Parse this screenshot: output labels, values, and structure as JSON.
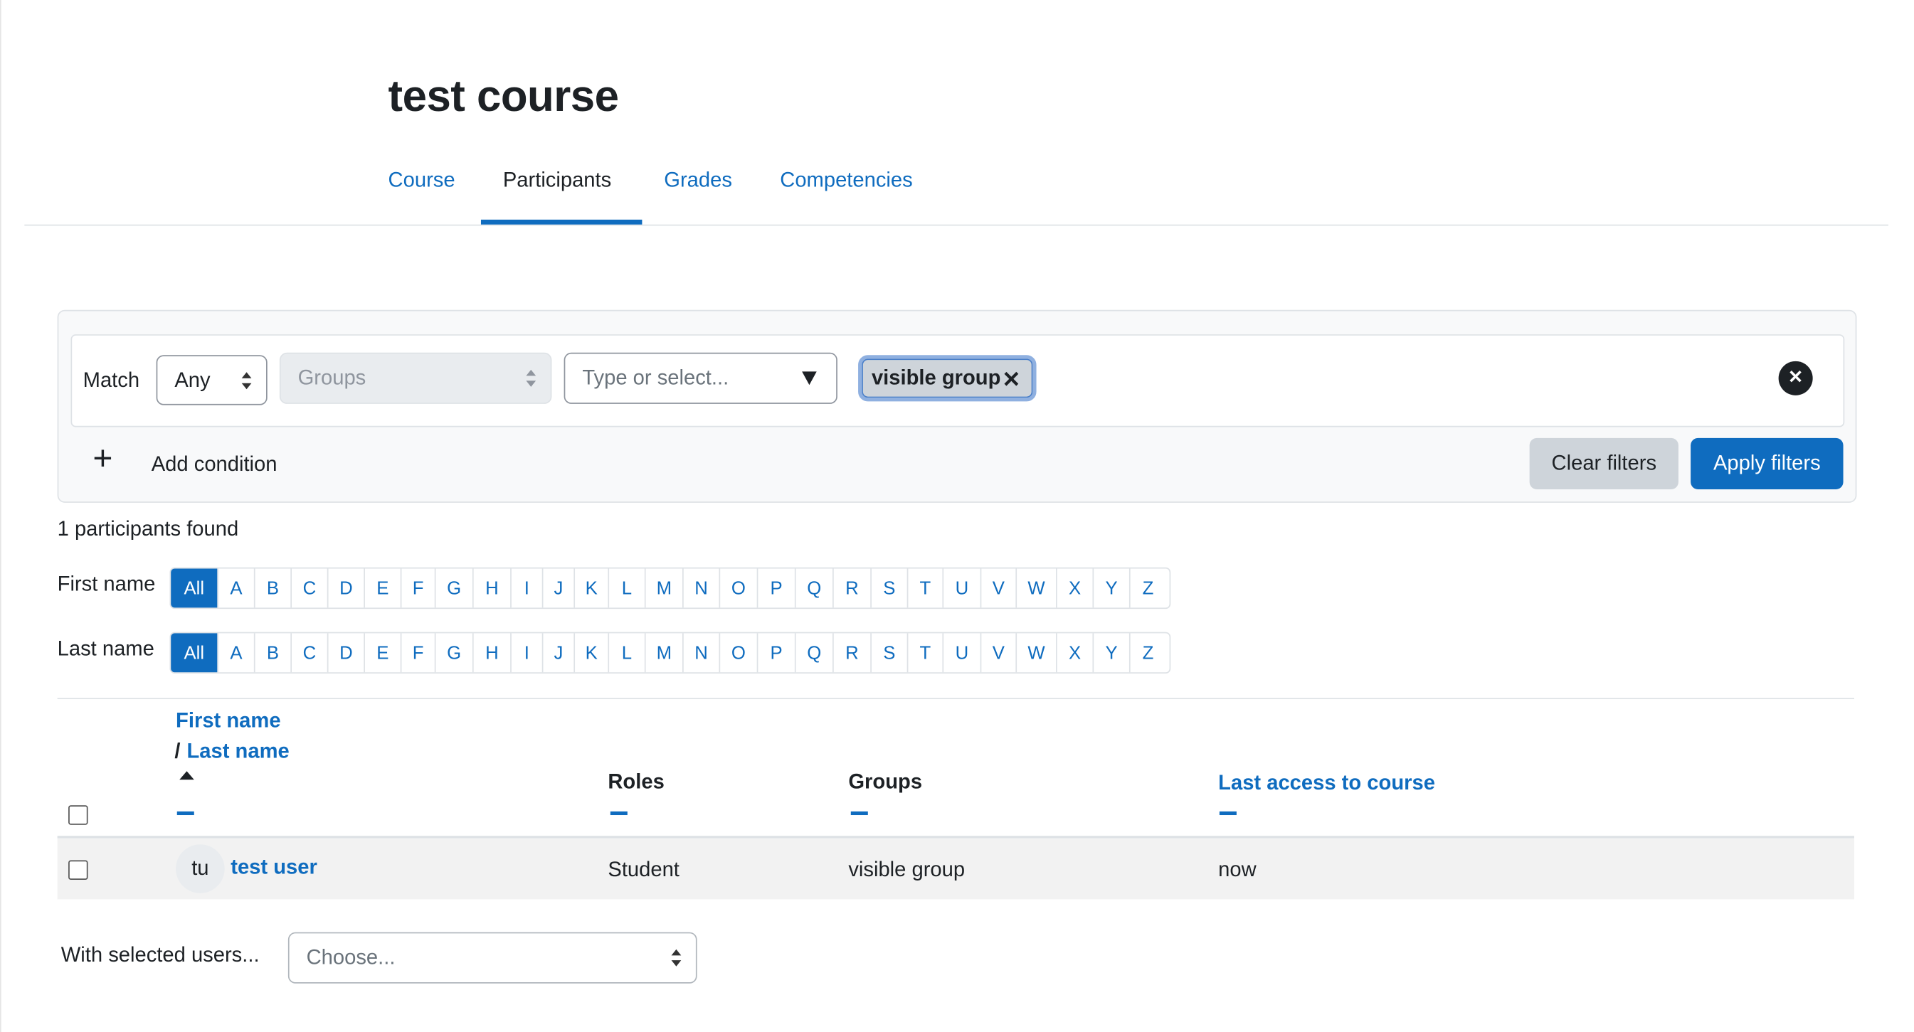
{
  "course_title": "test course",
  "tabs": [
    {
      "label": "Course"
    },
    {
      "label": "Participants"
    },
    {
      "label": "Grades"
    },
    {
      "label": "Competencies"
    }
  ],
  "filter": {
    "match_label": "Match",
    "match_value": "Any",
    "type_value": "Groups",
    "value_placeholder": "Type or select...",
    "chip_label": "visible group",
    "chip_remove": "✕",
    "clear_icon": "✕",
    "add_icon": "+",
    "add_condition": "Add condition",
    "clear_filters": "Clear filters",
    "apply_filters": "Apply filters"
  },
  "participants_found": "1 participants found",
  "initials": {
    "first_name_label": "First name",
    "last_name_label": "Last name",
    "letters": [
      "All",
      "A",
      "B",
      "C",
      "D",
      "E",
      "F",
      "G",
      "H",
      "I",
      "J",
      "K",
      "L",
      "M",
      "N",
      "O",
      "P",
      "Q",
      "R",
      "S",
      "T",
      "U",
      "V",
      "W",
      "X",
      "Y",
      "Z"
    ]
  },
  "table": {
    "col_first_name": "First name",
    "col_sep": "/",
    "col_last_name": "Last name",
    "col_roles": "Roles",
    "col_groups": "Groups",
    "col_last_access": "Last access to course",
    "rows": [
      {
        "initials": "tu",
        "name": "test user",
        "role": "Student",
        "group": "visible group",
        "last_access": "now"
      }
    ]
  },
  "bulk": {
    "label": "With selected users...",
    "placeholder": "Choose..."
  },
  "colors": {
    "accent": "#0f6cbf",
    "text": "#1d2125"
  }
}
